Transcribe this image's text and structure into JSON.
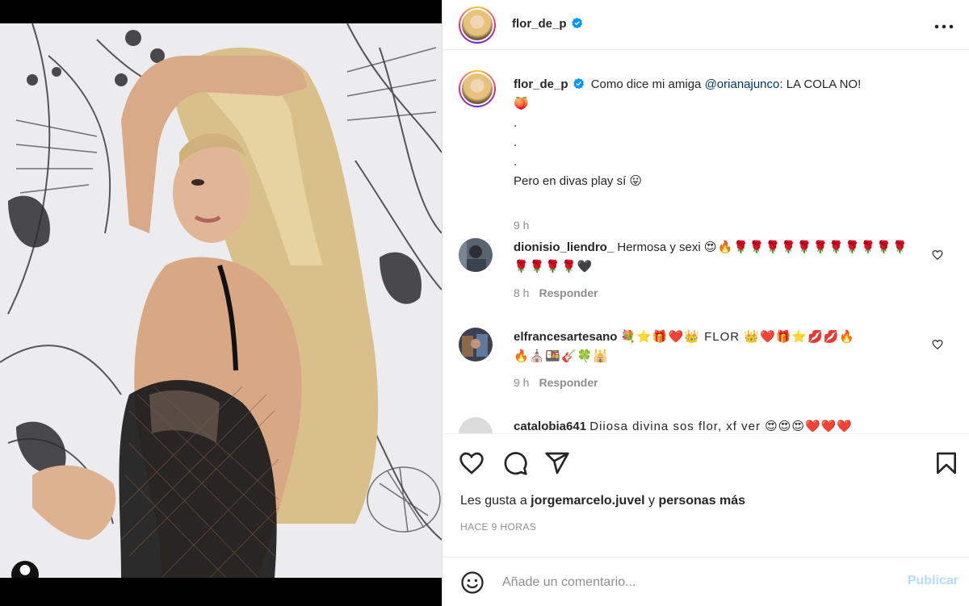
{
  "post": {
    "username": "flor_de_p",
    "more_icon": "more-horizontal-icon"
  },
  "caption": {
    "username": "flor_de_p",
    "text_before": "Como dice mi amiga ",
    "mention": "@orianajunco",
    "text_after": ": LA COLA NO!",
    "line2": "🍑",
    "dot1": ".",
    "dot2": ".",
    "dot3": ".",
    "line_last": "Pero en divas play sí 😛",
    "time": "9 h"
  },
  "comments": [
    {
      "username": "dionisio_liendro_",
      "text": "Hermosa y sexi",
      "emojis_line1": "😍🔥🌹🌹🌹🌹🌹🌹🌹🌹🌹🌹🌹",
      "emojis_line2": "🌹🌹🌹🌹🖤",
      "time": "8 h",
      "reply": "Responder"
    },
    {
      "username": "elfrancesartesano",
      "text": "💐⭐🎁❤️👑 FLOR 👑❤️🎁⭐💋💋🔥",
      "emojis_line2": "🔥⛪🍱🎸🍀🕌",
      "time": "9 h",
      "reply": "Responder"
    },
    {
      "username": "catalobia641",
      "text": "Diiosa divina sos flor, xf ver 😍😍😍❤️❤️❤️"
    }
  ],
  "actions": {
    "likes_prefix": "Les gusta a ",
    "likes_user": "jorgemarcelo.juvel",
    "likes_mid": " y ",
    "likes_suffix": "personas más",
    "posted": "HACE 9 HORAS"
  },
  "composer": {
    "placeholder": "Añade un comentario...",
    "publish": "Publicar"
  },
  "colors": {
    "link": "#00376b",
    "verified": "#0095f6",
    "publish_disabled": "#b3dbff",
    "muted": "#8e8e8e"
  }
}
